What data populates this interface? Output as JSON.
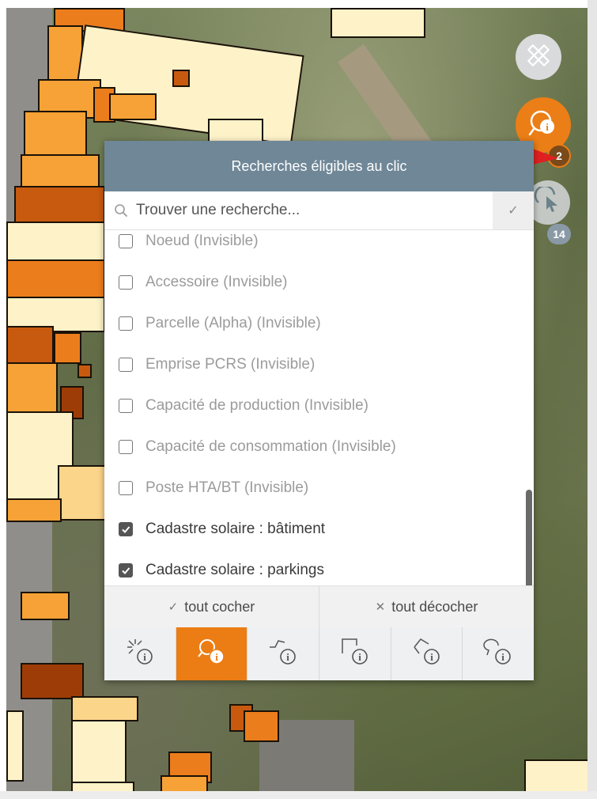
{
  "panel": {
    "title": "Recherches éligibles au clic",
    "search_placeholder": "Trouver une recherche...",
    "items": [
      {
        "label": "Noeud (Invisible)",
        "checked": false
      },
      {
        "label": "Accessoire (Invisible)",
        "checked": false
      },
      {
        "label": "Parcelle (Alpha) (Invisible)",
        "checked": false
      },
      {
        "label": "Emprise PCRS (Invisible)",
        "checked": false
      },
      {
        "label": "Capacité de production (Invisible)",
        "checked": false
      },
      {
        "label": "Capacité de consommation (Invisible)",
        "checked": false
      },
      {
        "label": "Poste HTA/BT (Invisible)",
        "checked": false
      },
      {
        "label": "Cadastre solaire : bâtiment",
        "checked": true
      },
      {
        "label": "Cadastre solaire : parkings",
        "checked": true
      }
    ],
    "check_all_label": "tout cocher",
    "uncheck_all_label": "tout décocher",
    "tools": [
      {
        "icon": "click-point-info-icon",
        "active": false
      },
      {
        "icon": "search-info-icon",
        "active": true
      },
      {
        "icon": "line-info-icon",
        "active": false
      },
      {
        "icon": "rectangle-info-icon",
        "active": false
      },
      {
        "icon": "polygon-info-icon",
        "active": false
      },
      {
        "icon": "lasso-info-icon",
        "active": false
      }
    ]
  },
  "floating_buttons": {
    "measure_icon": "ruler-pencil-icon",
    "info_icon": "search-info-icon",
    "info_badge": "2",
    "select_icon": "cursor-select-icon",
    "select_badge": "14"
  },
  "colors": {
    "header": "#6f8797",
    "accent_orange": "#ec7d14",
    "arrow": "#e02020"
  }
}
